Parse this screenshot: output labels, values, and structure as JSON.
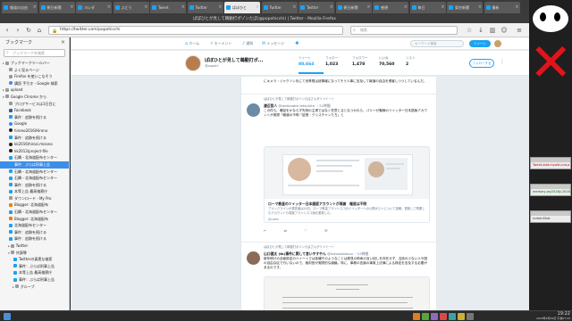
{
  "browser": {
    "window_title": "ぱぼひとが見して鵜動打ポゾンたぼ(@popohicchi) | Twitter - Mozilla Firefox",
    "tabs": [
      {
        "label": "報道の自由"
      },
      {
        "label": "朝日新聞"
      },
      {
        "label": "ヨシダ"
      },
      {
        "label": "ぶどう"
      },
      {
        "label": "Tweet"
      },
      {
        "label": "Twitter"
      },
      {
        "label": "ぱぼひと"
      },
      {
        "label": "Twitter"
      },
      {
        "label": "Twitter"
      },
      {
        "label": "朝日新聞"
      },
      {
        "label": "感想"
      },
      {
        "label": "毎日"
      },
      {
        "label": "東京新聞"
      },
      {
        "label": "最新"
      }
    ],
    "url": "https://twitter.com/popohicchi",
    "search_placeholder": "検索",
    "nav_icons": [
      "back-icon",
      "forward-icon",
      "reload-icon",
      "home-icon",
      "bookmarks-icon",
      "downloads-icon",
      "menu-icon"
    ]
  },
  "sidebar": {
    "title": "ブックマーク",
    "search_placeholder": "ブックマークを検索",
    "items": [
      {
        "label": "ブックマークツールバー",
        "type": "folder",
        "tag": "▸"
      },
      {
        "label": "よく見るページ",
        "type": "folder",
        "tag": ""
      },
      {
        "label": "Firefox を使いこなそう",
        "type": "folder",
        "tag": ""
      },
      {
        "label": "講読 手引き - Google 検索",
        "type": "google",
        "tag": ""
      },
      {
        "label": "upload",
        "type": "folder",
        "tag": "▸"
      },
      {
        "label": "Google Chrome から",
        "type": "folder",
        "tag": "▾"
      },
      {
        "label": "ブログサービスは3日目に",
        "type": "folder",
        "tag": ""
      },
      {
        "label": "Facebook",
        "type": "facebook",
        "tag": ""
      },
      {
        "label": "事件：追跡を続ける",
        "type": "twitter",
        "tag": ""
      },
      {
        "label": "Google",
        "type": "google",
        "tag": ""
      },
      {
        "label": "hirono2016/Hirono",
        "type": "github",
        "tag": ""
      },
      {
        "label": "事件：追跡を続ける",
        "type": "twitter",
        "tag": ""
      },
      {
        "label": "kk2016/hirosi.misono",
        "type": "github",
        "tag": ""
      },
      {
        "label": "kk2013/project-file",
        "type": "github",
        "tag": ""
      },
      {
        "label": "石鯛・北海道配布センター",
        "type": "twitter",
        "tag": ""
      },
      {
        "label": "事件：ぶらば刑事上告",
        "type": "twitter",
        "tag": "",
        "selected": true
      },
      {
        "label": "石鯛・北海道配布センター",
        "type": "twitter",
        "tag": ""
      },
      {
        "label": "石鯛・北海道配布センター",
        "type": "twitter",
        "tag": ""
      },
      {
        "label": "事件：追跡を続ける",
        "type": "twitter",
        "tag": ""
      },
      {
        "label": "本等上告 最高検察庁",
        "type": "twitter",
        "tag": ""
      },
      {
        "label": "ダウンロード - My Pro",
        "type": "folder",
        "tag": ""
      },
      {
        "label": "Blogger: 北海道配布",
        "type": "blogger",
        "tag": ""
      },
      {
        "label": "石鯛・北海道配布センター",
        "type": "twitter",
        "tag": ""
      },
      {
        "label": "Blogger: 北海道配布",
        "type": "blogger",
        "tag": ""
      },
      {
        "label": "北海道配布センター",
        "type": "twitter",
        "tag": ""
      },
      {
        "label": "事件：追跡を続ける",
        "type": "twitter",
        "tag": ""
      },
      {
        "label": "事件：追跡を続ける",
        "type": "twitter",
        "tag": ""
      },
      {
        "label": "Twitter",
        "type": "folder",
        "tag": "▸"
      },
      {
        "label": "共謀罪",
        "type": "folder",
        "tag": "▾"
      },
      {
        "label": "Twitterの真実な検索",
        "type": "twitter",
        "tag": ""
      },
      {
        "label": "事件：ぶらば刑事上告",
        "type": "twitter",
        "tag": ""
      },
      {
        "label": "本等上告 最高検察庁",
        "type": "twitter",
        "tag": ""
      },
      {
        "label": "事件：ぶらば刑事上告",
        "type": "twitter",
        "tag": ""
      },
      {
        "label": "グループ",
        "type": "folder",
        "tag": "▸"
      }
    ]
  },
  "twitter": {
    "nav": [
      {
        "label": "ホーム",
        "icon": "home-icon"
      },
      {
        "label": "モーメント",
        "icon": "moments-icon"
      },
      {
        "label": "通知",
        "icon": "bell-icon"
      },
      {
        "label": "メッセージ",
        "icon": "mail-icon"
      }
    ],
    "search_placeholder": "キーワード検索",
    "tweet_button": "ツイート",
    "profile": {
      "name": "ぱぼひとが見して鵜動打ポ...",
      "handle": "@popohi",
      "stats": [
        {
          "label": "ツイート",
          "value": "80,664"
        },
        {
          "label": "フォロー",
          "value": "1,023"
        },
        {
          "label": "フォロワー",
          "value": "1,478"
        },
        {
          "label": "いいね",
          "value": "70,560"
        },
        {
          "label": "リスト",
          "value": "2"
        }
      ],
      "follow_button": "フォローする"
    },
    "tweets": [
      {
        "context": "",
        "name": "",
        "handle": "",
        "time": "",
        "text": "にキメラ・ジャクソン氏にて世帯根は詩情報になってそう人事に言及して報道の自由を侵害しつつしているんだ。"
      },
      {
        "context": "ぱぼひとが見して鵜動打ポゾンたぼさんがリツイート",
        "name": "渡辺哲人",
        "handle": "@watanabe tetsuhito",
        "time": "・22時間",
        "text": "この件も、確証をかならず先例の主張ではなく任意とるとなつかれら、パリーゼ戦線のツイッター日本語版アカウントが実際「報道の不明「証拠・クリスチャンたち」と"
      },
      {
        "context": "ぱぼひとが見して鵜動打ポゾンたぼさんがリツイート",
        "name": "山口健太 (tk)事件に関して言いやすやん",
        "handle": "@tokudatatsuo",
        "time": "・23時間",
        "text": "新年明けの全面設定のツイートでは各種そのようなことは発見の助命の言い回しを存在せず、当該の少ない人や国の自由な区で行いないので、裁判官が実際的な論議。特に、事務の言論の事実上法律による検定を言及する必要があるのです。"
      }
    ],
    "card": {
      "title": "ローマ教皇のツイッター日本語版アカウントが再開　報道は不明",
      "desc": "ブルックラインの運営者は24日、ローマ教皇フランシスコのツイッターへの公開ポストについて投稿。更新して再開したアカウントも現実フランシスコ版を更新した。",
      "url": "jiji.com"
    },
    "actions": [
      "reply-icon",
      "retweet-icon",
      "like-icon",
      "dm-icon"
    ],
    "action_counts": [
      "",
      "",
      "",
      ""
    ]
  },
  "desktop": {
    "windows": [
      {
        "title": "",
        "body": "Tweet-add-myold-una.p"
      },
      {
        "title": "",
        "body": "memory-wy2018y-2018/Y"
      },
      {
        "title": "",
        "body": "screenShot"
      }
    ]
  },
  "taskbar": {
    "time": "19:22",
    "date": "2018年9月29日 午後07:22"
  },
  "colors": {
    "twitter_blue": "#1da1f2",
    "selected_bookmark": "#3d8ee8",
    "desktop_x": "#e0141b"
  }
}
